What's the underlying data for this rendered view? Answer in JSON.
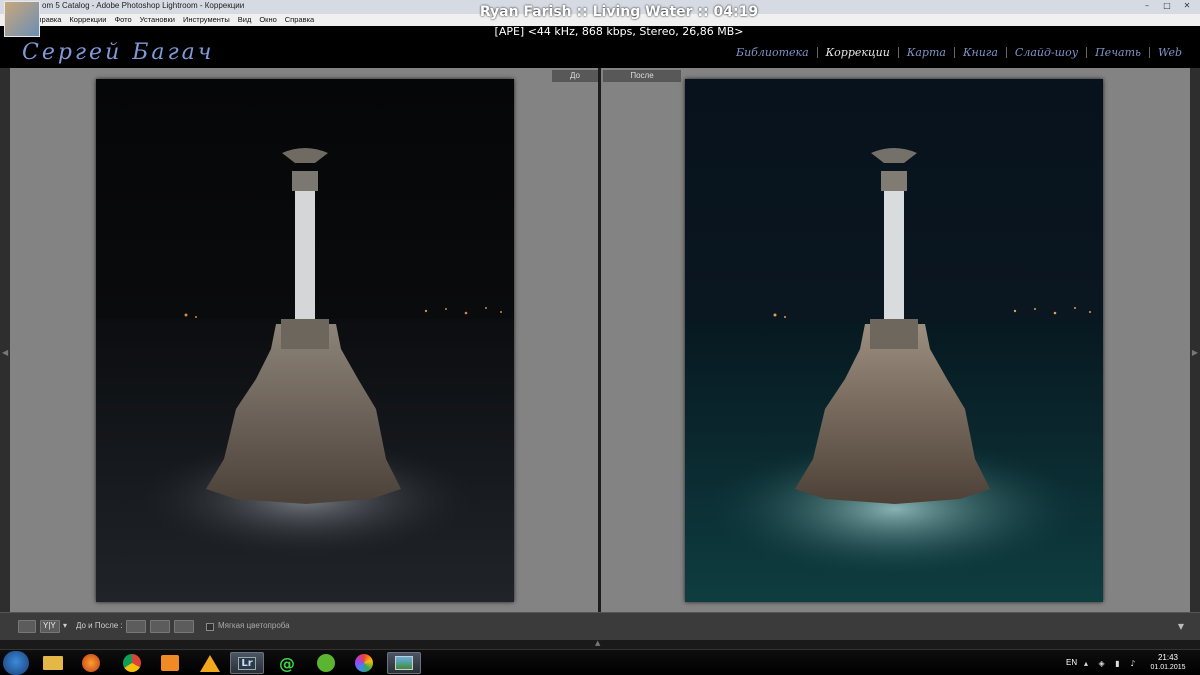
{
  "window": {
    "title": "om 5 Catalog - Adobe Photoshop Lightroom - Коррекции",
    "controls": [
      "–",
      "□",
      "✕"
    ]
  },
  "menu": [
    "Справка",
    "Коррекции",
    "Фото",
    "Установки",
    "Инструменты",
    "Вид",
    "Окно",
    "Справка"
  ],
  "media": {
    "now_playing": "Ryan Farish :: Living Water :: 04:19",
    "info": "[APE] <44 kHz, 868 kbps, Stereo, 26,86 MB>"
  },
  "identity_plate": "Сергей Багач",
  "modules": [
    {
      "label": "Библиотека",
      "active": false
    },
    {
      "label": "Коррекции",
      "active": true
    },
    {
      "label": "Карта",
      "active": false
    },
    {
      "label": "Книга",
      "active": false
    },
    {
      "label": "Слайд-шоу",
      "active": false
    },
    {
      "label": "Печать",
      "active": false
    },
    {
      "label": "Web",
      "active": false
    }
  ],
  "panes": {
    "before_label": "До",
    "after_label": "После"
  },
  "toolbar": {
    "view_mode_icon": "loupe-icon",
    "compare_mode": "Y|Y",
    "before_after_label": "До и После :",
    "soft_proof_label": "Мягкая цветопроба",
    "soft_proof_checked": false
  },
  "taskbar": {
    "apps": [
      {
        "name": "explorer",
        "icon": "folder-icon"
      },
      {
        "name": "firefox",
        "icon": "firefox-icon"
      },
      {
        "name": "chrome",
        "icon": "chrome-icon"
      },
      {
        "name": "media-player",
        "icon": "play-icon"
      },
      {
        "name": "aimp",
        "icon": "aimp-icon"
      },
      {
        "name": "lightroom",
        "icon": "lr-icon",
        "label": "Lr"
      },
      {
        "name": "mail-agent",
        "icon": "at-icon",
        "label": "@"
      },
      {
        "name": "utorrent",
        "icon": "utorrent-icon"
      },
      {
        "name": "picasa",
        "icon": "picasa-icon"
      },
      {
        "name": "image-viewer",
        "icon": "picture-icon"
      }
    ],
    "language": "EN",
    "time": "21:43",
    "date": "01.01.2015"
  },
  "colors": {
    "identity": "#7f9ad6",
    "module_inactive": "#8092c8",
    "module_active": "#e6e6e6",
    "pane_bg": "#838383"
  }
}
